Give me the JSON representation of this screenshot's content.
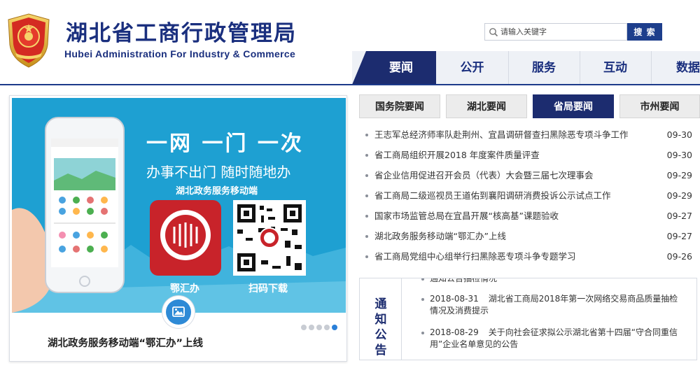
{
  "header": {
    "title": "湖北省工商行政管理局",
    "subtitle": "Hubei Administration For Industry & Commerce"
  },
  "search": {
    "placeholder": "请输入关键字",
    "button_label": "搜 索"
  },
  "main_nav": {
    "items": [
      {
        "label": "要闻",
        "active": true
      },
      {
        "label": "公开",
        "active": false
      },
      {
        "label": "服务",
        "active": false
      },
      {
        "label": "互动",
        "active": false
      },
      {
        "label": "数据",
        "active": false
      }
    ]
  },
  "slider": {
    "banner": {
      "headline": "一网 一门 一次",
      "tagline": "办事不出门 随时随地办",
      "label": "湖北政务服务移动端",
      "app_name": "鄂汇办",
      "qr_label": "扫码下载"
    },
    "caption": "湖北政务服务移动端“鄂汇办”上线",
    "dots": 5,
    "active_dot": 4
  },
  "news_tabs": [
    {
      "label": "国务院要闻",
      "active": false
    },
    {
      "label": "湖北要闻",
      "active": false
    },
    {
      "label": "省局要闻",
      "active": true
    },
    {
      "label": "市州要闻",
      "active": false
    }
  ],
  "news": [
    {
      "title": "王志军总经济师率队赴荆州、宜昌调研督查扫黑除恶专项斗争工作",
      "date": "09-30"
    },
    {
      "title": "省工商局组织开展2018 年度案件质量评查",
      "date": "09-30"
    },
    {
      "title": "省企业信用促进召开会员（代表）大会暨三届七次理事会",
      "date": "09-29"
    },
    {
      "title": "省工商局二级巡视员王道佑到襄阳调研消费投诉公示试点工作",
      "date": "09-29"
    },
    {
      "title": "国家市场监管总局在宜昌开展“核高基”课题验收",
      "date": "09-27"
    },
    {
      "title": "湖北政务服务移动端“鄂汇办”上线",
      "date": "09-27"
    },
    {
      "title": "省工商局党组中心组举行扫黑除恶专项斗争专题学习",
      "date": "09-26"
    }
  ],
  "notice": {
    "label": "通知公告",
    "items": [
      {
        "date": "",
        "title": "通知公告抽检情况"
      },
      {
        "date": "2018-08-31",
        "title": "湖北省工商局2018年第一次网络交易商品质量抽检情况及消费提示"
      },
      {
        "date": "2018-08-29",
        "title": "关于向社会征求拟公示湖北省第十四届“守合同重信用”企业名单意见的公告"
      }
    ]
  },
  "colors": {
    "brand_blue": "#1a2f7e",
    "nav_active": "#1c2c6f",
    "banner_bg": "#1ea0d2",
    "app_red": "#c8232a"
  }
}
